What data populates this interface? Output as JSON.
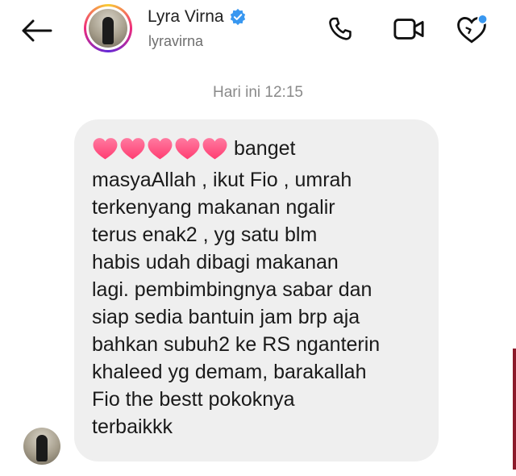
{
  "header": {
    "back_icon": "arrow-left-icon",
    "display_name": "Lyra Virna",
    "verified_icon": "verified-badge-icon",
    "username": "lyravirna",
    "icons": [
      "phone-icon",
      "video-camera-icon",
      "heart-shield-icon"
    ],
    "notification_dot_color": "#3897f0"
  },
  "conversation": {
    "timestamp": "Hari ini 12:15",
    "message": {
      "emoji_icon": "pink-heart-icon",
      "emoji_count": 5,
      "first_line_text": "banget",
      "lines": [
        "masyaAllah , ikut Fio , umrah",
        "terkenyang makanan ngalir",
        "terus enak2 , yg satu blm",
        "habis udah dibagi makanan",
        "lagi. pembimbingnya sabar dan",
        "siap sedia bantuin jam brp aja",
        "bahkan subuh2 ke RS nganterin",
        "khaleed yg demam, barakallah",
        "Fio the bestt pokoknya",
        "terbaikkk"
      ]
    }
  },
  "colors": {
    "bubble_background": "#efefef",
    "heart": "#ff5c8a",
    "verified_blue": "#3897f0"
  }
}
